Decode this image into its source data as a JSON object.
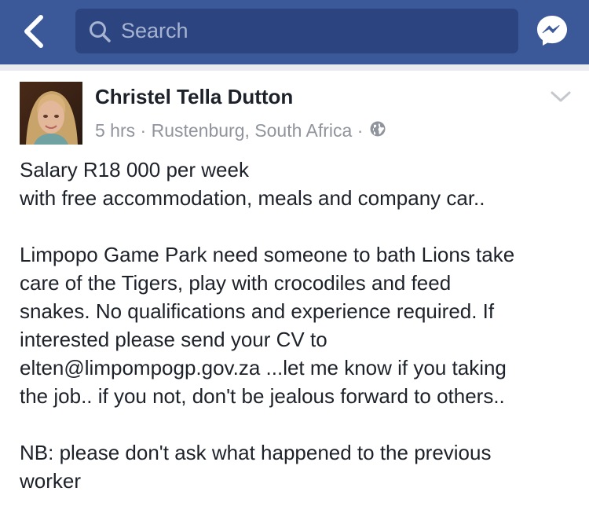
{
  "header": {
    "search_placeholder": "Search",
    "icons": {
      "back": "chevron-left-icon",
      "search": "search-icon",
      "messenger": "messenger-icon"
    },
    "colors": {
      "bar": "#3b5998",
      "search_field": "#2c4580"
    }
  },
  "post": {
    "author": "Christel Tella Dutton",
    "time": "5 hrs",
    "location": "Rustenburg, South Africa",
    "separator": "·",
    "privacy_icon": "globe-icon",
    "menu_icon": "chevron-down-icon",
    "paragraphs": [
      "Salary R18 000 per week\nwith free accommodation, meals and company car..",
      "Limpopo Game Park need someone to bath Lions take\ncare of the Tigers, play with crocodiles and feed\nsnakes. No qualifications and experience required. If\ninterested please send your CV to\nelten@limpompogp.gov.za ...let me know if you taking\nthe job.. if you not, don't be jealous forward to others..",
      "NB: please don't ask what happened to the previous\nworker"
    ]
  }
}
